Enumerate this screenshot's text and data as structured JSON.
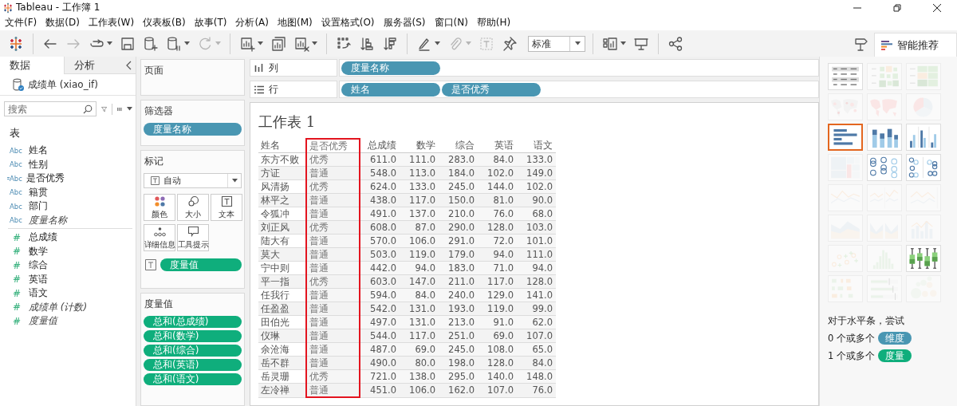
{
  "window": {
    "title": "Tableau - 工作簿 1"
  },
  "menu": [
    "文件(F)",
    "数据(D)",
    "工作表(W)",
    "仪表板(B)",
    "故事(T)",
    "分析(A)",
    "地图(M)",
    "设置格式(O)",
    "服务器(S)",
    "窗口(N)",
    "帮助(H)"
  ],
  "toolbar": [
    {
      "kind": "logo",
      "disabled": false,
      "menu": false
    },
    {
      "kind": "back",
      "disabled": false,
      "menu": false
    },
    {
      "kind": "forward",
      "disabled": true,
      "menu": false
    },
    {
      "kind": "loop",
      "disabled": false,
      "menu": true
    },
    {
      "kind": "save",
      "disabled": false,
      "menu": false
    },
    {
      "kind": "new-datasource",
      "disabled": false,
      "menu": false
    },
    {
      "kind": "pause-datasource",
      "disabled": false,
      "menu": true
    },
    {
      "kind": "refresh",
      "disabled": true,
      "menu": true
    },
    {
      "kind": "new-sheet",
      "disabled": false,
      "menu": true
    },
    {
      "kind": "duplicate-sheet",
      "disabled": false,
      "menu": false
    },
    {
      "kind": "clear-sheet",
      "disabled": false,
      "menu": true
    },
    {
      "kind": "swap",
      "disabled": false,
      "menu": false
    },
    {
      "kind": "sort-asc",
      "disabled": false,
      "menu": false
    },
    {
      "kind": "sort-desc",
      "disabled": false,
      "menu": false
    },
    {
      "kind": "highlight",
      "disabled": false,
      "menu": true
    },
    {
      "kind": "annotate",
      "disabled": true,
      "menu": true
    },
    {
      "kind": "labels",
      "disabled": true,
      "menu": false
    },
    {
      "kind": "pin",
      "disabled": false,
      "menu": false
    },
    {
      "kind": "fit"
    },
    {
      "kind": "show-cards",
      "disabled": false,
      "menu": true
    },
    {
      "kind": "presentation",
      "disabled": false,
      "menu": false
    },
    {
      "kind": "share",
      "disabled": false,
      "menu": false
    }
  ],
  "fit_dropdown": {
    "value": "标准"
  },
  "show_me_tab": {
    "label": "智能推荐",
    "selected": true
  },
  "data_pane": {
    "tabs": [
      {
        "label": "数据",
        "selected": true
      },
      {
        "label": "分析",
        "selected": false
      }
    ],
    "datasource": "成绩单 (xiao_if)",
    "search": {
      "placeholder": "搜索"
    },
    "section": "表",
    "fields": [
      {
        "kind": "dimension",
        "type_label": "Abc",
        "name": "姓名",
        "italic": false
      },
      {
        "kind": "dimension",
        "type_label": "Abc",
        "name": "性别",
        "italic": false
      },
      {
        "kind": "calculated",
        "type_label": "Abc",
        "name": "是否优秀",
        "italic": false
      },
      {
        "kind": "dimension",
        "type_label": "Abc",
        "name": "籍贯",
        "italic": false
      },
      {
        "kind": "dimension",
        "type_label": "Abc",
        "name": "部门",
        "italic": false
      },
      {
        "kind": "dimension",
        "type_label": "Abc",
        "name": "度量名称",
        "italic": true
      },
      {
        "kind": "measure",
        "type_label": "#",
        "name": "总成绩",
        "italic": false
      },
      {
        "kind": "measure",
        "type_label": "#",
        "name": "数学",
        "italic": false
      },
      {
        "kind": "measure",
        "type_label": "#",
        "name": "综合",
        "italic": false
      },
      {
        "kind": "measure",
        "type_label": "#",
        "name": "英语",
        "italic": false
      },
      {
        "kind": "measure",
        "type_label": "#",
        "name": "语文",
        "italic": false
      },
      {
        "kind": "measure",
        "type_label": "#",
        "name": "成绩单 (计数)",
        "italic": true
      },
      {
        "kind": "measure",
        "type_label": "#",
        "name": "度量值",
        "italic": true
      }
    ]
  },
  "pages_card": {
    "title": "页面"
  },
  "filters_card": {
    "title": "筛选器",
    "pills": [
      {
        "label": "度量名称",
        "kind": "dimension"
      }
    ]
  },
  "marks_card": {
    "title": "标记",
    "mark_type": "自动",
    "buttons": [
      {
        "kind": "color",
        "label": "颜色"
      },
      {
        "kind": "size",
        "label": "大小"
      },
      {
        "kind": "text",
        "label": "文本"
      },
      {
        "kind": "detail",
        "label": "详细信息"
      },
      {
        "kind": "tooltip",
        "label": "工具提示"
      }
    ],
    "encodings": [
      {
        "kind": "text",
        "pill": {
          "label": "度量值",
          "kind": "measure"
        }
      }
    ]
  },
  "measure_values_card": {
    "title": "度量值",
    "pills": [
      {
        "label": "总和(总成绩)",
        "kind": "measure"
      },
      {
        "label": "总和(数学)",
        "kind": "measure"
      },
      {
        "label": "总和(综合)",
        "kind": "measure"
      },
      {
        "label": "总和(英语)",
        "kind": "measure"
      },
      {
        "label": "总和(语文)",
        "kind": "measure"
      }
    ]
  },
  "columns_shelf": {
    "label": "列",
    "pills": [
      {
        "label": "度量名称",
        "kind": "dimension"
      }
    ]
  },
  "rows_shelf": {
    "label": "行",
    "pills": [
      {
        "label": "姓名",
        "kind": "dimension"
      },
      {
        "label": "是否优秀",
        "kind": "dimension"
      }
    ]
  },
  "sheet": {
    "title": "工作表 1",
    "columns": [
      {
        "label": "姓名",
        "kind": "dimension",
        "highlighted": false
      },
      {
        "label": "是否优秀",
        "kind": "dimension",
        "highlighted": true
      },
      {
        "label": "总成绩",
        "kind": "measure",
        "highlighted": false
      },
      {
        "label": "数学",
        "kind": "measure",
        "highlighted": false
      },
      {
        "label": "综合",
        "kind": "measure",
        "highlighted": false
      },
      {
        "label": "英语",
        "kind": "measure",
        "highlighted": false
      },
      {
        "label": "语文",
        "kind": "measure",
        "highlighted": false
      }
    ],
    "rows": [
      [
        "东方不败",
        "优秀",
        "611.0",
        "111.0",
        "283.0",
        "84.0",
        "133.0"
      ],
      [
        "方证",
        "普通",
        "548.0",
        "113.0",
        "184.0",
        "102.0",
        "149.0"
      ],
      [
        "风清扬",
        "优秀",
        "624.0",
        "133.0",
        "245.0",
        "144.0",
        "102.0"
      ],
      [
        "林平之",
        "普通",
        "438.0",
        "117.0",
        "150.0",
        "81.0",
        "90.0"
      ],
      [
        "令狐冲",
        "普通",
        "491.0",
        "137.0",
        "210.0",
        "76.0",
        "68.0"
      ],
      [
        "刘正风",
        "优秀",
        "608.0",
        "87.0",
        "290.0",
        "128.0",
        "103.0"
      ],
      [
        "陆大有",
        "普通",
        "570.0",
        "106.0",
        "291.0",
        "72.0",
        "101.0"
      ],
      [
        "莫大",
        "普通",
        "503.0",
        "119.0",
        "179.0",
        "94.0",
        "111.0"
      ],
      [
        "宁中则",
        "普通",
        "442.0",
        "94.0",
        "183.0",
        "71.0",
        "94.0"
      ],
      [
        "平一指",
        "优秀",
        "603.0",
        "147.0",
        "211.0",
        "117.0",
        "128.0"
      ],
      [
        "任我行",
        "普通",
        "594.0",
        "84.0",
        "240.0",
        "129.0",
        "141.0"
      ],
      [
        "任盈盈",
        "普通",
        "542.0",
        "131.0",
        "193.0",
        "119.0",
        "99.0"
      ],
      [
        "田伯光",
        "普通",
        "497.0",
        "131.0",
        "213.0",
        "91.0",
        "62.0"
      ],
      [
        "仪琳",
        "普通",
        "544.0",
        "117.0",
        "251.0",
        "69.0",
        "107.0"
      ],
      [
        "余沧海",
        "普通",
        "487.0",
        "69.0",
        "245.0",
        "108.0",
        "65.0"
      ],
      [
        "岳不群",
        "普通",
        "490.0",
        "80.0",
        "198.0",
        "128.0",
        "84.0"
      ],
      [
        "岳灵珊",
        "优秀",
        "721.0",
        "138.0",
        "295.0",
        "140.0",
        "148.0"
      ],
      [
        "左冷禅",
        "普通",
        "451.0",
        "106.0",
        "162.0",
        "107.0",
        "76.0"
      ]
    ]
  },
  "show_me": {
    "thumbnails": [
      {
        "kind": "text-table",
        "selected": false,
        "disabled": false
      },
      {
        "kind": "heat-map",
        "selected": false,
        "disabled": true
      },
      {
        "kind": "highlight-table",
        "selected": false,
        "disabled": true
      },
      {
        "kind": "symbol-map",
        "selected": false,
        "disabled": true
      },
      {
        "kind": "filled-map",
        "selected": false,
        "disabled": true
      },
      {
        "kind": "pie",
        "selected": false,
        "disabled": true
      },
      {
        "kind": "hbar",
        "selected": true,
        "disabled": false
      },
      {
        "kind": "stacked-bar",
        "selected": false,
        "disabled": false
      },
      {
        "kind": "side-bar",
        "selected": false,
        "disabled": false
      },
      {
        "kind": "treemap",
        "selected": false,
        "disabled": true
      },
      {
        "kind": "circle-views",
        "selected": false,
        "disabled": false
      },
      {
        "kind": "side-circle",
        "selected": false,
        "disabled": false
      },
      {
        "kind": "lines-continuous",
        "selected": false,
        "disabled": true
      },
      {
        "kind": "lines-discrete",
        "selected": false,
        "disabled": true
      },
      {
        "kind": "dual-lines",
        "selected": false,
        "disabled": true
      },
      {
        "kind": "area-continuous",
        "selected": false,
        "disabled": true
      },
      {
        "kind": "area-discrete",
        "selected": false,
        "disabled": true
      },
      {
        "kind": "dual-combination",
        "selected": false,
        "disabled": true
      },
      {
        "kind": "scatter",
        "selected": false,
        "disabled": true
      },
      {
        "kind": "histogram",
        "selected": false,
        "disabled": true
      },
      {
        "kind": "box-whisker",
        "selected": false,
        "disabled": false
      },
      {
        "kind": "gantt",
        "selected": false,
        "disabled": true
      },
      {
        "kind": "bullet",
        "selected": false,
        "disabled": true
      },
      {
        "kind": "packed-bubbles",
        "selected": false,
        "disabled": true
      }
    ],
    "hint": "对于水平条，尝试",
    "requirements": [
      {
        "text": "0 个或多个",
        "pill": "维度",
        "kind": "dimension"
      },
      {
        "text": "1 个或多个",
        "pill": "度量",
        "kind": "measure"
      }
    ]
  }
}
